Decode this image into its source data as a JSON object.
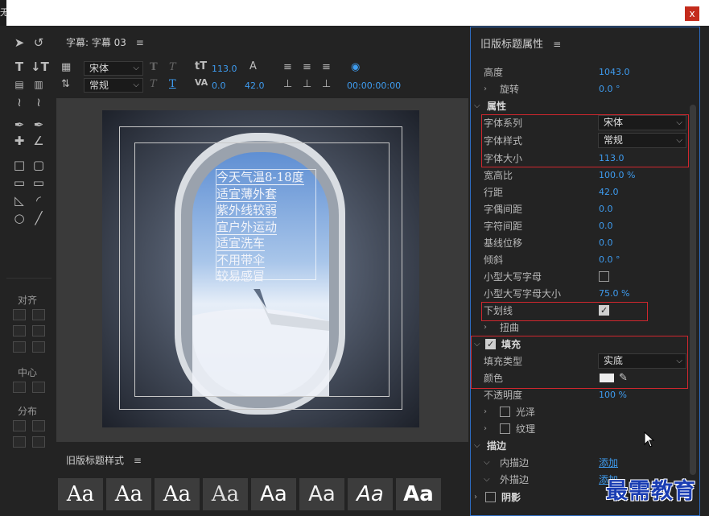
{
  "window": {
    "close_label": "x",
    "left_edge_text": "无"
  },
  "editor": {
    "tab_title": "字幕: 字幕 03",
    "menu_glyph": "≡",
    "font_family": "宋体",
    "font_style": "常规",
    "font_size": "113.0",
    "leading": "42.0",
    "kerning": "0.0",
    "tracking": "0.0",
    "timecode": "00:00:00:00"
  },
  "text_lines": [
    "今天气温8-18度",
    "适宜薄外套",
    "紫外线较弱",
    "宜户外运动",
    "适宜洗车",
    "不用带伞",
    "较易感冒"
  ],
  "tools_panel": {
    "align_title": "对齐",
    "center_title": "中心",
    "distribute_title": "分布"
  },
  "styles_panel": {
    "title": "旧版标题样式",
    "swatch_label": "Aa"
  },
  "props": {
    "title": "旧版标题属性",
    "height_label": "高度",
    "height_value": "1043.0",
    "rotation_label": "旋转",
    "rotation_value": "0.0 °",
    "attributes_label": "属性",
    "font_family_label": "字体系列",
    "font_family_value": "宋体",
    "font_style_label": "字体样式",
    "font_style_value": "常规",
    "font_size_label": "字体大小",
    "font_size_value": "113.0",
    "aspect_label": "宽高比",
    "aspect_value": "100.0 %",
    "leading_label": "行距",
    "leading_value": "42.0",
    "kerning_label": "字偶间距",
    "kerning_value": "0.0",
    "tracking_label": "字符间距",
    "tracking_value": "0.0",
    "baseline_label": "基线位移",
    "baseline_value": "0.0",
    "slant_label": "倾斜",
    "slant_value": "0.0 °",
    "smallcaps_label": "小型大写字母",
    "smallcaps_size_label": "小型大写字母大小",
    "smallcaps_size_value": "75.0 %",
    "underline_label": "下划线",
    "distort_label": "扭曲",
    "fill_label": "填充",
    "fill_type_label": "填充类型",
    "fill_type_value": "实底",
    "color_label": "颜色",
    "color_value": "#eeeeee",
    "opacity_label": "不透明度",
    "opacity_value": "100 %",
    "sheen_label": "光泽",
    "texture_label": "纹理",
    "stroke_label": "描边",
    "inner_stroke_label": "内描边",
    "outer_stroke_label": "外描边",
    "add_label": "添加",
    "shadow_label": "阴影"
  },
  "watermark": "最需教育",
  "colors": {
    "accent": "#3e9cf0",
    "highlight": "#d0272e",
    "panel": "#232323"
  }
}
